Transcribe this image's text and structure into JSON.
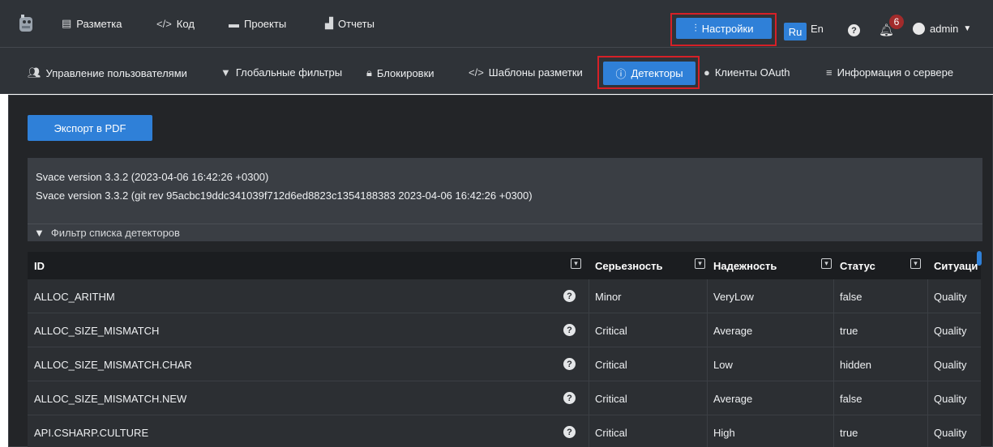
{
  "topnav": {
    "items": [
      {
        "icon": "layout-icon",
        "label": "Разметка"
      },
      {
        "icon": "code-icon",
        "label": "Код"
      },
      {
        "icon": "archive-icon",
        "label": "Проекты"
      },
      {
        "icon": "chart-icon",
        "label": "Отчеты"
      }
    ],
    "settings_label": "Настройки",
    "lang_ru": "Ru",
    "lang_en": "En",
    "notifications_count": "6",
    "user_label": "admin"
  },
  "subnav": {
    "items": [
      {
        "icon": "users-icon",
        "label": "Управление пользователями"
      },
      {
        "icon": "filter-icon",
        "label": "Глобальные фильтры"
      },
      {
        "icon": "lock-icon",
        "label": "Блокировки"
      },
      {
        "icon": "code-icon",
        "label": "Шаблоны разметки"
      },
      {
        "icon": "alert-icon",
        "label": "Детекторы"
      },
      {
        "icon": "user-icon",
        "label": "Клиенты OAuth"
      },
      {
        "icon": "database-icon",
        "label": "Информация о сервере"
      }
    ]
  },
  "content": {
    "export_label": "Экспорт в PDF",
    "version_line_1": "Svace version 3.3.2 (2023-04-06 16:42:26 +0300)",
    "version_line_2": "Svace version 3.3.2 (git rev 95acbc19ddc341039f712d6ed8823c1354188383 2023-04-06 16:42:26 +0300)",
    "filter_placeholder": "Фильтр списка детекторов"
  },
  "table": {
    "columns": [
      "ID",
      "Серьезность",
      "Надежность",
      "Статус",
      "Ситуаци"
    ],
    "rows": [
      [
        "ALLOC_ARITHM",
        "Minor",
        "VeryLow",
        "false",
        "Quality"
      ],
      [
        "ALLOC_SIZE_MISMATCH",
        "Critical",
        "Average",
        "true",
        "Quality"
      ],
      [
        "ALLOC_SIZE_MISMATCH.CHAR",
        "Critical",
        "Low",
        "hidden",
        "Quality"
      ],
      [
        "ALLOC_SIZE_MISMATCH.NEW",
        "Critical",
        "Average",
        "false",
        "Quality"
      ],
      [
        "API.CSHARP.CULTURE",
        "Critical",
        "High",
        "true",
        "Quality"
      ]
    ]
  },
  "colors": {
    "accent": "#2f80d8",
    "highlight": "#d62027",
    "bar": "#2f3338",
    "panel": "#232528"
  }
}
